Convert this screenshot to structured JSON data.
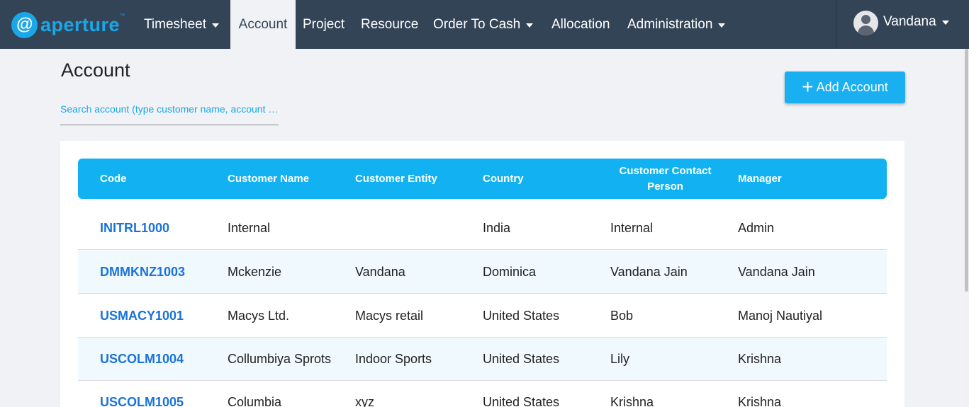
{
  "brand": {
    "logo_glyph": "@",
    "name": "aperture",
    "tm": "™",
    "color": "#1aa7e8"
  },
  "nav": {
    "items": [
      {
        "label": "Timesheet",
        "dropdown": true,
        "active": false
      },
      {
        "label": "Account",
        "dropdown": false,
        "active": true
      },
      {
        "label": "Project",
        "dropdown": false,
        "active": false
      },
      {
        "label": "Resource",
        "dropdown": false,
        "active": false
      },
      {
        "label": "Order To Cash",
        "dropdown": true,
        "active": false
      },
      {
        "label": "Allocation",
        "dropdown": false,
        "active": false
      },
      {
        "label": "Administration",
        "dropdown": true,
        "active": false
      }
    ],
    "user": {
      "name": "Vandana",
      "icon": "user-avatar-icon"
    }
  },
  "page": {
    "title": "Account",
    "search_placeholder": "Search account (type customer name, account …",
    "add_button": "Add Account",
    "add_icon": "plus-icon"
  },
  "table": {
    "headers": [
      "Code",
      "Customer Name",
      "Customer Entity",
      "Country",
      "Customer Contact Person",
      "Manager"
    ],
    "rows": [
      [
        "INITRL1000",
        "Internal",
        "",
        "India",
        "Internal",
        "Admin"
      ],
      [
        "DMMKNZ1003",
        "Mckenzie",
        "Vandana",
        "Dominica",
        "Vandana Jain",
        "Vandana Jain"
      ],
      [
        "USMACY1001",
        "Macys Ltd.",
        "Macys retail",
        "United States",
        "Bob",
        "Manoj Nautiyal"
      ],
      [
        "USCOLM1004",
        "Collumbiya Sprots",
        "Indoor Sports",
        "United States",
        "Lily",
        "Krishna"
      ],
      [
        "USCOLM1005",
        "Columbia",
        "xyz",
        "United States",
        "Krishna",
        "Krishna"
      ]
    ]
  },
  "colors": {
    "navbar": "#344457",
    "accent": "#12b2f2",
    "code_link": "#1a73d9",
    "row_alt": "#f0f9fe"
  }
}
